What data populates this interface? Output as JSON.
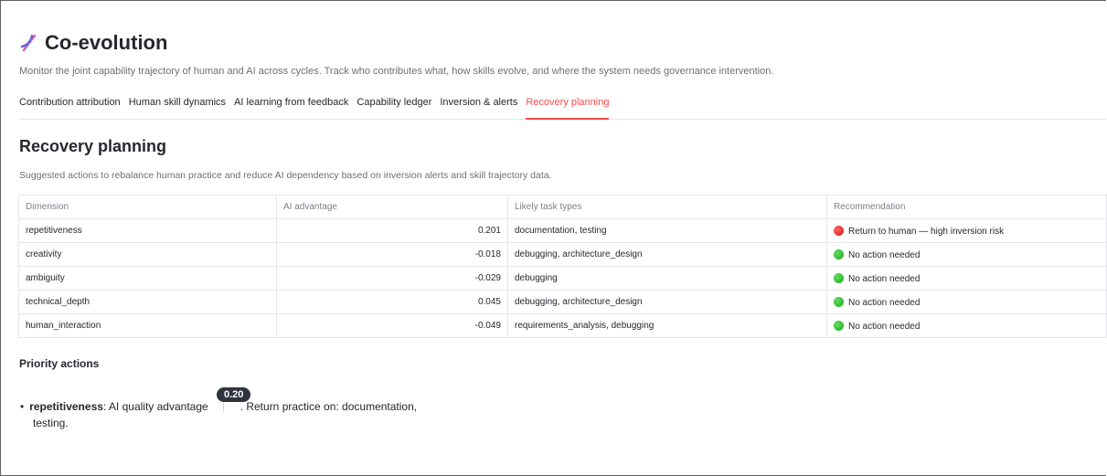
{
  "header": {
    "icon": "dna-icon",
    "title": "Co-evolution",
    "description": "Monitor the joint capability trajectory of human and AI across cycles. Track who contributes what, how skills evolve, and where the system needs governance intervention."
  },
  "tabs": [
    {
      "label": "Contribution attribution",
      "active": false
    },
    {
      "label": "Human skill dynamics",
      "active": false
    },
    {
      "label": "AI learning from feedback",
      "active": false
    },
    {
      "label": "Capability ledger",
      "active": false
    },
    {
      "label": "Inversion & alerts",
      "active": false
    },
    {
      "label": "Recovery planning",
      "active": true
    }
  ],
  "colors": {
    "accent": "#ff4b4b",
    "badge": "#31333f",
    "red_status": "#e01e1e",
    "green_status": "#2dbb2d"
  },
  "section": {
    "title": "Recovery planning",
    "description": "Suggested actions to rebalance human practice and reduce AI dependency based on inversion alerts and skill trajectory data."
  },
  "table": {
    "columns": [
      "Dimension",
      "AI advantage",
      "Likely task types",
      "Recommendation"
    ],
    "rows": [
      {
        "dimension": "repetitiveness",
        "ai_advantage": "0.201",
        "task_types": "documentation, testing",
        "status": "red",
        "recommendation": "Return to human — high inversion risk"
      },
      {
        "dimension": "creativity",
        "ai_advantage": "-0.018",
        "task_types": "debugging, architecture_design",
        "status": "green",
        "recommendation": "No action needed"
      },
      {
        "dimension": "ambiguity",
        "ai_advantage": "-0.029",
        "task_types": "debugging",
        "status": "green",
        "recommendation": "No action needed"
      },
      {
        "dimension": "technical_depth",
        "ai_advantage": "0.045",
        "task_types": "debugging, architecture_design",
        "status": "green",
        "recommendation": "No action needed"
      },
      {
        "dimension": "human_interaction",
        "ai_advantage": "-0.049",
        "task_types": "requirements_analysis, debugging",
        "status": "green",
        "recommendation": "No action needed"
      }
    ]
  },
  "priority": {
    "title": "Priority actions",
    "bullet": "•",
    "items": [
      {
        "dimension": "repetitiveness",
        "text_before": ": AI quality advantage",
        "badge": "0.20",
        "text_after": ". Return practice on: documentation,",
        "text_cont": "testing."
      }
    ]
  }
}
